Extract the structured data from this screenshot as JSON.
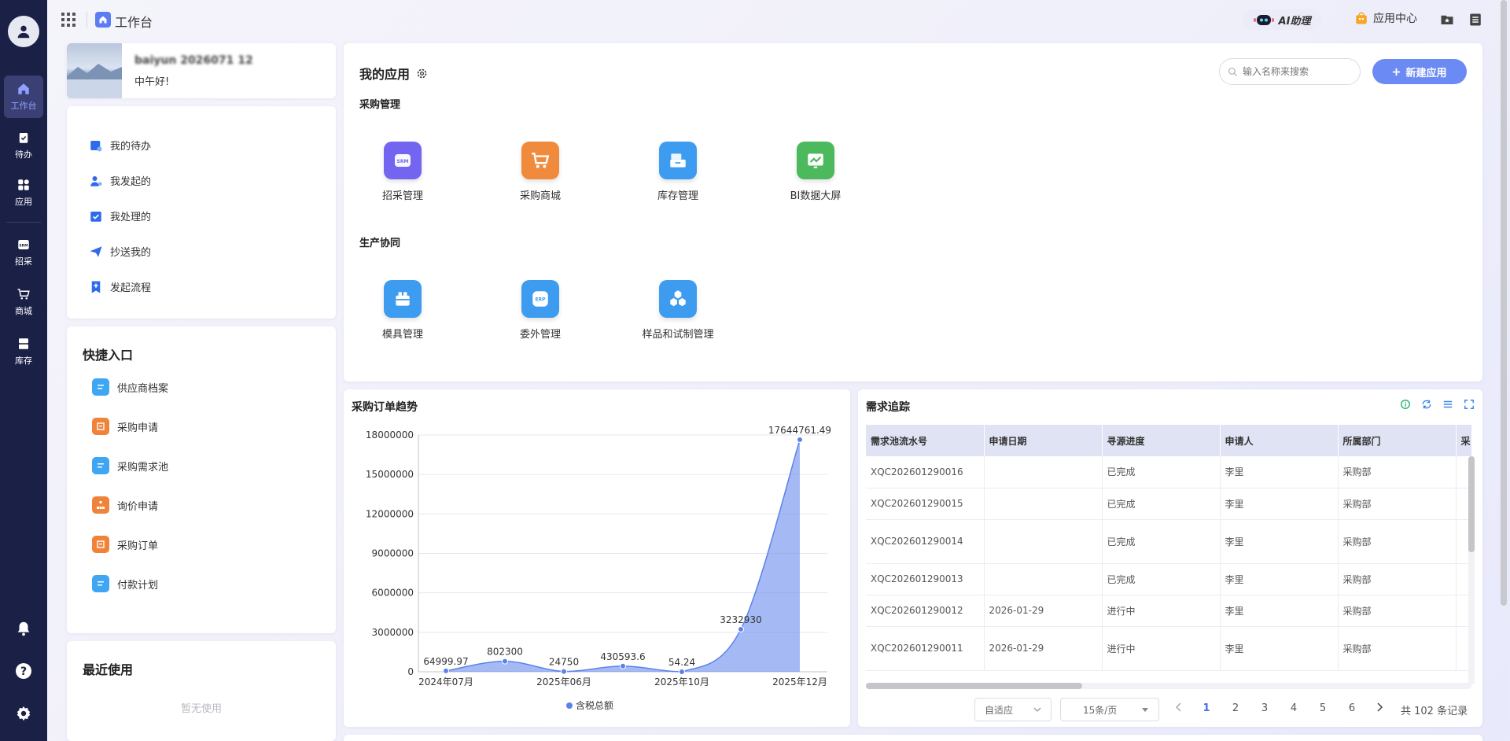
{
  "topbar": {
    "title": "工作台",
    "ai_label": "AI助理",
    "app_center_label": "应用中心"
  },
  "rail": {
    "items": [
      {
        "label": "工作台",
        "icon": "home-icon"
      },
      {
        "label": "待办",
        "icon": "clipboard-check-icon"
      },
      {
        "label": "应用",
        "icon": "apps-grid-icon"
      },
      {
        "label": "招采",
        "icon": "srm-icon"
      },
      {
        "label": "商城",
        "icon": "cart-icon"
      },
      {
        "label": "库存",
        "icon": "inventory-icon"
      }
    ]
  },
  "user": {
    "name": "baiyun 2026071 12",
    "greeting": "中午好!"
  },
  "side": {
    "items": [
      {
        "label": "我的待办"
      },
      {
        "label": "我发起的"
      },
      {
        "label": "我处理的"
      },
      {
        "label": "抄送我的"
      },
      {
        "label": "发起流程"
      }
    ]
  },
  "quick": {
    "title": "快捷入口",
    "items": [
      {
        "label": "供应商档案",
        "color": "#3ea6f2"
      },
      {
        "label": "采购申请",
        "color": "#f0833a"
      },
      {
        "label": "采购需求池",
        "color": "#3ea6f2"
      },
      {
        "label": "询价申请",
        "color": "#f0833a"
      },
      {
        "label": "采购订单",
        "color": "#f0833a"
      },
      {
        "label": "付款计划",
        "color": "#3ea6f2"
      }
    ]
  },
  "recent": {
    "title": "最近使用",
    "empty_text": "暂无使用"
  },
  "apps": {
    "title": "我的应用",
    "search_placeholder": "输入名称来搜索",
    "new_button": "新建应用",
    "groups": [
      {
        "title": "采购管理",
        "items": [
          {
            "label": "招采管理",
            "color": "#7465f0",
            "badge": "SRM"
          },
          {
            "label": "采购商城",
            "color": "#f08a3c",
            "badge": ""
          },
          {
            "label": "库存管理",
            "color": "#3d9cf0",
            "badge": ""
          },
          {
            "label": "BI数据大屏",
            "color": "#4cb95c",
            "badge": ""
          }
        ]
      },
      {
        "title": "生产协同",
        "items": [
          {
            "label": "模具管理",
            "color": "#3d9cf0",
            "badge": ""
          },
          {
            "label": "委外管理",
            "color": "#3d9cf0",
            "badge": "ERP"
          },
          {
            "label": "样品和试制管理",
            "color": "#3d9cf0",
            "badge": ""
          }
        ]
      }
    ]
  },
  "chart_data": {
    "type": "area",
    "title": "采购订单趋势",
    "x": [
      "2024年07月",
      "",
      "2025年06月",
      "",
      "2025年10月",
      "",
      "2025年12月"
    ],
    "x_tick_labels": [
      "2024年07月",
      "2025年06月",
      "2025年10月",
      "2025年12月"
    ],
    "series": [
      {
        "name": "含税总额",
        "values": [
          64999.97,
          802300,
          24750,
          430593.6,
          54.24,
          3232930,
          17644761.49
        ],
        "labels": [
          "64999.97",
          "802300",
          "24750",
          "430593.6",
          "54.24",
          "3232930",
          "17644761.49"
        ],
        "color": "#5b82ec"
      }
    ],
    "y_ticks": [
      "0",
      "3000000",
      "6000000",
      "9000000",
      "12000000",
      "15000000",
      "18000000"
    ],
    "ylim": [
      0,
      18000000
    ],
    "grid": true,
    "legend": "bottom"
  },
  "tracking": {
    "title": "需求追踪",
    "columns": [
      "需求池流水号",
      "申请日期",
      "寻源进度",
      "申请人",
      "所属部门",
      "采"
    ],
    "rows": [
      [
        "XQC202601290016",
        "",
        "已完成",
        "李里",
        "采购部"
      ],
      [
        "XQC202601290015",
        "",
        "已完成",
        "李里",
        "采购部"
      ],
      [
        "XQC202601290014",
        "",
        "已完成",
        "李里",
        "采购部"
      ],
      [
        "XQC202601290013",
        "",
        "已完成",
        "李里",
        "采购部"
      ],
      [
        "XQC202601290012",
        "2026-01-29",
        "进行中",
        "李里",
        "采购部"
      ],
      [
        "XQC202601290011",
        "2026-01-29",
        "进行中",
        "李里",
        "采购部"
      ]
    ],
    "pager": {
      "size_mode": "自适应",
      "page_size": "15条/页",
      "pages": [
        "1",
        "2",
        "3",
        "4",
        "5",
        "6"
      ],
      "current": "1",
      "total": "共 102 条记录"
    }
  }
}
